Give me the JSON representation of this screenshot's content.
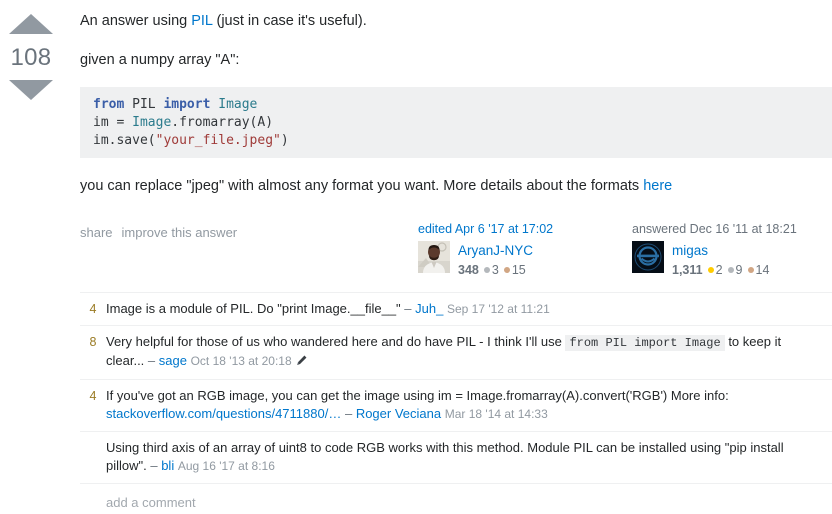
{
  "vote": {
    "up_icon": "upvote-arrow-icon",
    "down_icon": "downvote-arrow-icon",
    "score": "108"
  },
  "post": {
    "paragraph1_pre": "An answer using ",
    "paragraph1_link": "PIL",
    "paragraph1_post": " (just in case it's useful).",
    "paragraph2": "given a numpy array \"A\":",
    "code": {
      "line1": [
        {
          "t": "from ",
          "c": "kw"
        },
        {
          "t": "PIL ",
          "c": "pln"
        },
        {
          "t": "import ",
          "c": "kw"
        },
        {
          "t": "Image",
          "c": "cls"
        }
      ],
      "line2": [
        {
          "t": "im ",
          "c": "pln"
        },
        {
          "t": "= ",
          "c": "pln"
        },
        {
          "t": "Image",
          "c": "cls"
        },
        {
          "t": ".fromarray(A)",
          "c": "pln"
        }
      ],
      "line3": [
        {
          "t": "im.save(",
          "c": "pln"
        },
        {
          "t": "\"your_file.jpeg\"",
          "c": "str"
        },
        {
          "t": ")",
          "c": "pln"
        }
      ],
      "plain": "from PIL import Image\nim = Image.fromarray(A)\nim.save(\"your_file.jpeg\")"
    },
    "paragraph3_pre": "you can replace \"jpeg\" with almost any format you want. More details about the formats ",
    "paragraph3_link": "here"
  },
  "actions": {
    "share": "share",
    "improve": "improve this answer"
  },
  "editor": {
    "action": "edited Apr 6 '17 at 17:02",
    "avatar_name": "avatar-aryanj-nyc",
    "username": "AryanJ-NYC",
    "reputation": "348",
    "badges": [
      {
        "type": "silver",
        "count": "3"
      },
      {
        "type": "bronze",
        "count": "15"
      }
    ]
  },
  "author": {
    "action": "answered Dec 16 '11 at 18:21",
    "avatar_name": "avatar-migas",
    "username": "migas",
    "reputation": "1,311",
    "badges": [
      {
        "type": "gold",
        "count": "2"
      },
      {
        "type": "silver",
        "count": "9"
      },
      {
        "type": "bronze",
        "count": "14"
      }
    ]
  },
  "comments": [
    {
      "score": "4",
      "text_pre": "Image is a module of PIL. Do \"print Image.__file__\"",
      "code": null,
      "text_post": "",
      "user": "Juh_",
      "date": "Sep 17 '12 at 11:21",
      "has_edit_pencil": false
    },
    {
      "score": "8",
      "text_pre": "Very helpful for those of us who wandered here and do have PIL - I think I'll use",
      "code": "from PIL import Image",
      "text_post": "to keep it clear...",
      "user": "sage",
      "date": "Oct 18 '13 at 20:18",
      "has_edit_pencil": true
    },
    {
      "score": "4",
      "text_pre": "If you've got an RGB image, you can get the image using im = Image.fromarray(A).convert('RGB') More info:",
      "code": null,
      "link": "stackoverflow.com/questions/4711880/…",
      "text_post": "",
      "user": "Roger Veciana",
      "date": "Mar 18 '14 at 14:33",
      "has_edit_pencil": false
    },
    {
      "score": "",
      "text_pre": "Using third axis of an array of uint8 to code RGB works with this method. Module PIL can be installed using \"pip install pillow\".",
      "code": null,
      "text_post": "",
      "user": "bli",
      "date": "Aug 16 '17 at 8:16",
      "has_edit_pencil": false
    }
  ],
  "add_comment": {
    "label": "add a comment"
  },
  "colors": {
    "link": "#0077cc",
    "muted": "#9199a1",
    "code_bg": "#eff0f1",
    "gold": "#ffcc01",
    "silver": "#b4b8bc",
    "bronze": "#d1a684"
  }
}
